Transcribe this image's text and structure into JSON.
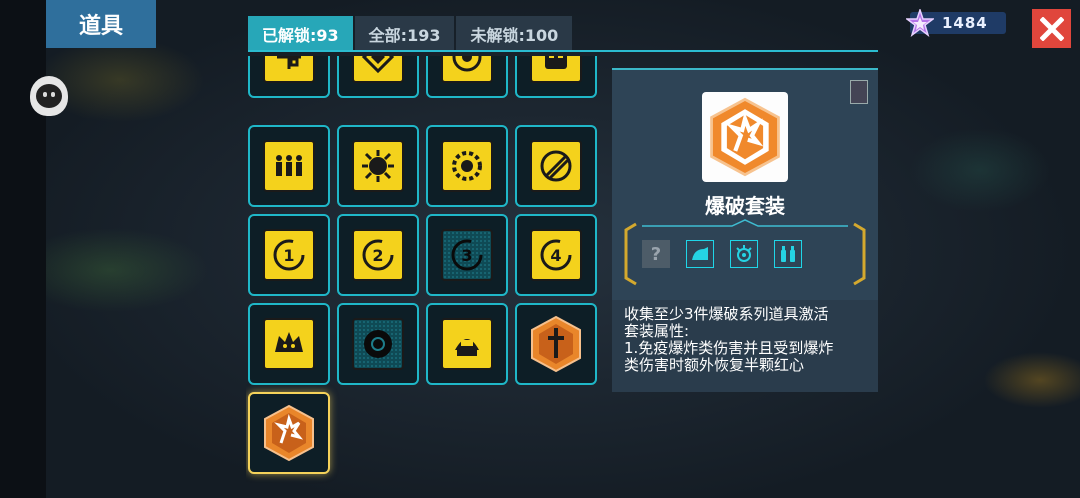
{
  "header": {
    "title": "道具"
  },
  "tabs": [
    {
      "label": "已解锁:93",
      "active": true
    },
    {
      "label": "全部:193",
      "active": false
    },
    {
      "label": "未解锁:100",
      "active": false
    }
  ],
  "currency": {
    "value": "1484",
    "icon": "purple-star-gem-icon"
  },
  "close": {
    "icon": "close-x-icon"
  },
  "grid": {
    "items": [
      {
        "icon": "cross-arrows-icon",
        "style": "gold"
      },
      {
        "icon": "diamond-icon",
        "style": "gold"
      },
      {
        "icon": "round-target-icon",
        "style": "gold"
      },
      {
        "icon": "skull-face-icon",
        "style": "gold"
      },
      {
        "icon": "three-figures-icon",
        "style": "gold"
      },
      {
        "icon": "sun-core-icon",
        "style": "gold"
      },
      {
        "icon": "gear-eye-icon",
        "style": "gold"
      },
      {
        "icon": "swirl-icon",
        "style": "gold"
      },
      {
        "icon": "number-1-icon",
        "style": "gold",
        "label": "1"
      },
      {
        "icon": "number-2-icon",
        "style": "gold",
        "label": "2"
      },
      {
        "icon": "number-3-icon",
        "style": "dark",
        "label": "3"
      },
      {
        "icon": "number-4-icon",
        "style": "gold",
        "label": "4"
      },
      {
        "icon": "beast-icon",
        "style": "gold"
      },
      {
        "icon": "dark-disc-icon",
        "style": "dark"
      },
      {
        "icon": "robot-dome-icon",
        "style": "gold"
      },
      {
        "icon": "sword-hexagon-icon",
        "style": "orange"
      },
      {
        "icon": "explosion-hexagon-icon",
        "style": "orange",
        "selected": true
      }
    ]
  },
  "detail": {
    "name": "爆破套装",
    "icon": "explosion-hexagon-icon",
    "set_slots": [
      {
        "icon": "question-mark-icon",
        "known": false
      },
      {
        "icon": "bomb-cap-icon",
        "known": true
      },
      {
        "icon": "explosion-icon",
        "known": true
      },
      {
        "icon": "twin-bottles-icon",
        "known": true
      }
    ],
    "unknown_glyph": "?",
    "description_lines": [
      "收集至少3件爆破系列道具激活",
      "套装属性:",
      "1.免疫爆炸类伤害并且受到爆炸",
      "类伤害时额外恢复半颗红心"
    ]
  }
}
